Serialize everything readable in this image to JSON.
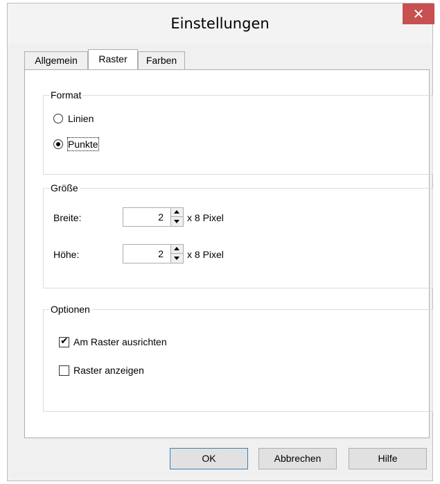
{
  "window": {
    "title": "Einstellungen",
    "close_glyph": "✕"
  },
  "tabs": [
    {
      "label": "Allgemein",
      "active": false
    },
    {
      "label": "Raster",
      "active": true
    },
    {
      "label": "Farben",
      "active": false
    }
  ],
  "format": {
    "legend": "Format",
    "options": [
      {
        "label": "Linien",
        "selected": false
      },
      {
        "label": "Punkte",
        "selected": true
      }
    ]
  },
  "size": {
    "legend": "Größe",
    "width": {
      "label": "Breite:",
      "value": "2",
      "unit": "x 8 Pixel"
    },
    "height": {
      "label": "Höhe:",
      "value": "2",
      "unit": "x 8 Pixel"
    }
  },
  "options": {
    "legend": "Optionen",
    "snap": {
      "label": "Am Raster ausrichten",
      "checked": true
    },
    "show": {
      "label": "Raster anzeigen",
      "checked": false
    }
  },
  "buttons": {
    "ok": "OK",
    "cancel": "Abbrechen",
    "help": "Hilfe"
  },
  "colors": {
    "close_bg": "#c75050",
    "default_button_border": "#3c7fb1"
  }
}
